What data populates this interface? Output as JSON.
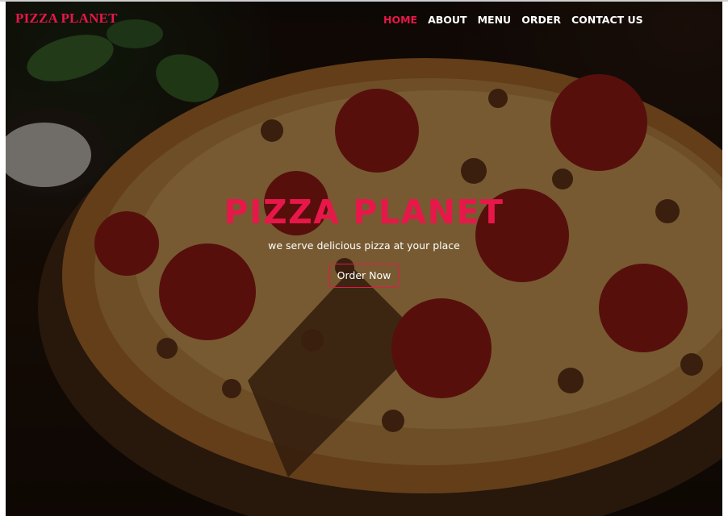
{
  "navbar": {
    "brand": "PIZZA PLANET",
    "items": [
      {
        "label": "HOME",
        "active": true
      },
      {
        "label": "ABOUT",
        "active": false
      },
      {
        "label": "MENU",
        "active": false
      },
      {
        "label": "ORDER",
        "active": false
      },
      {
        "label": "CONTACT US",
        "active": false
      }
    ]
  },
  "hero": {
    "title": "PIZZA PLANET",
    "subtitle": "we serve delicious pizza at your place",
    "button_label": "Order Now",
    "background_icon": "pizza-photo"
  },
  "colors": {
    "accent": "#e8174a",
    "text": "#ffffff",
    "background": "#140b07"
  }
}
